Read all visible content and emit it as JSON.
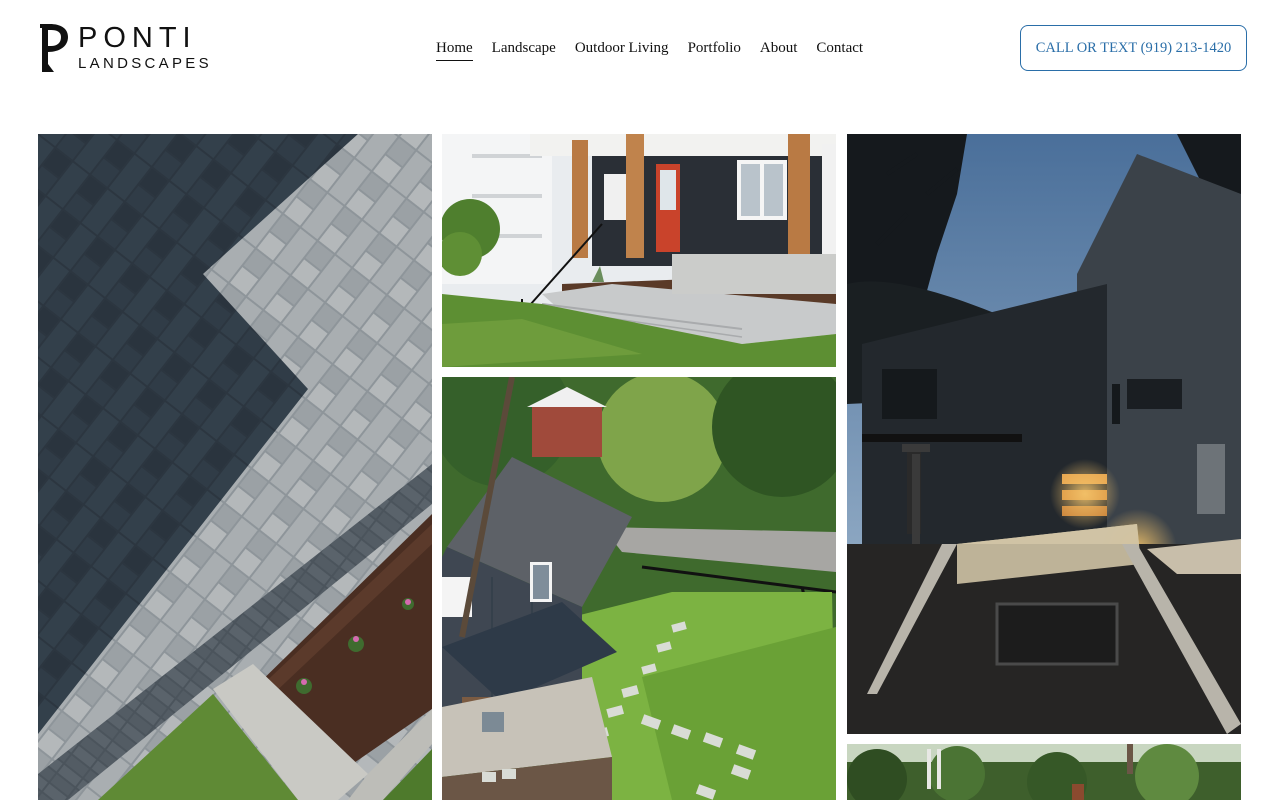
{
  "logo": {
    "top": "PONTI",
    "bottom": "LANDSCAPES"
  },
  "nav": {
    "items": [
      {
        "label": "Home",
        "active": true
      },
      {
        "label": "Landscape"
      },
      {
        "label": "Outdoor Living"
      },
      {
        "label": "Portfolio"
      },
      {
        "label": "About"
      },
      {
        "label": "Contact"
      }
    ]
  },
  "cta": {
    "label": "CALL OR TEXT (919) 213-1420"
  },
  "colors": {
    "accent": "#2a6ea8"
  },
  "gallery": {
    "images": [
      {
        "name": "paver-patio-photo"
      },
      {
        "name": "front-porch-stone-wall-photo"
      },
      {
        "name": "backyard-aerial-photo"
      },
      {
        "name": "night-lighting-patio-photo"
      },
      {
        "name": "garden-photo"
      }
    ]
  }
}
